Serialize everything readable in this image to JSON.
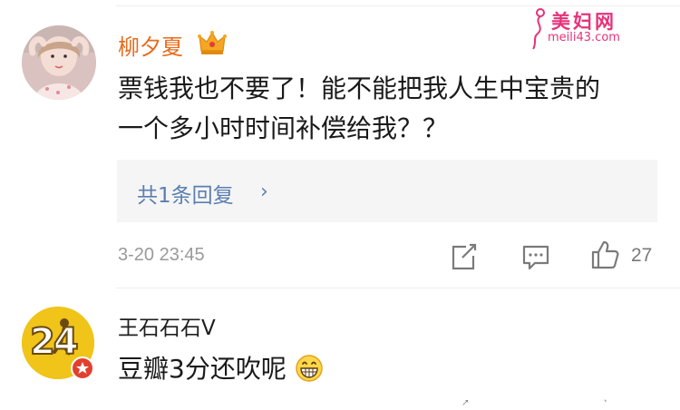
{
  "watermark": {
    "title": "美妇网",
    "url": "meili43.com"
  },
  "comments": [
    {
      "username": "柳夕夏",
      "text_line1": "票钱我也不要了！能不能把我人生中宝贵的",
      "text_line2": "一个多小时时间补偿给我？？",
      "reply_label": "共1条回复",
      "reply_chevron": "›",
      "time": "3-20 23:45",
      "like_count": "27",
      "icons": [
        "crown-icon",
        "share-icon",
        "comment-icon",
        "like-icon"
      ],
      "colors": {
        "username": "#e86b1c",
        "reply_link": "#5b7fb1"
      }
    },
    {
      "username": "王石石石V",
      "avatar_text": "24",
      "text": "豆瓣3分还吹呢",
      "icons": [
        "grin-emoji-icon",
        "star-badge-icon"
      ]
    }
  ]
}
